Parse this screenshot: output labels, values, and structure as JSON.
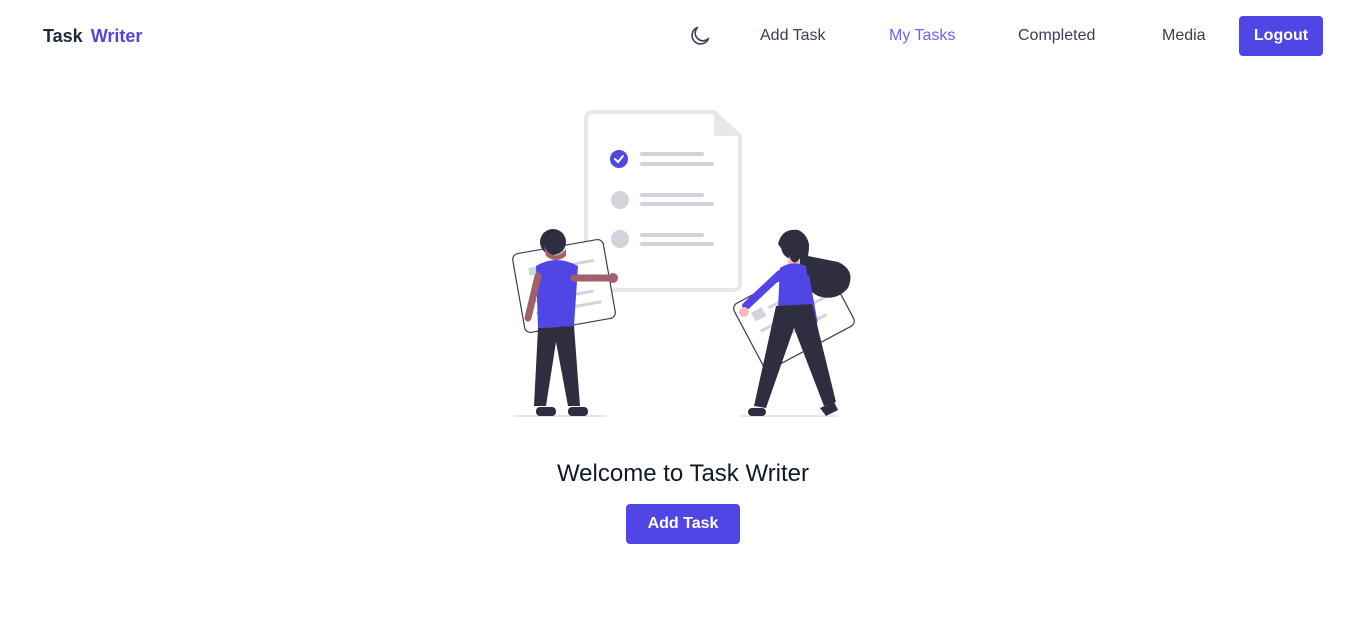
{
  "app": {
    "brand_first": "Task",
    "brand_second": "Writer",
    "accent_color": "#4f46e5"
  },
  "nav": {
    "theme_icon": "moon-icon",
    "links": [
      {
        "label": "Add Task",
        "active": false
      },
      {
        "label": "My Tasks",
        "active": true
      },
      {
        "label": "Completed",
        "active": false
      },
      {
        "label": "Media",
        "active": false
      }
    ],
    "logout_label": "Logout"
  },
  "hero": {
    "illustration": "task-checklist-illustration",
    "welcome_text": "Welcome to Task Writer",
    "add_task_label": "Add Task"
  }
}
